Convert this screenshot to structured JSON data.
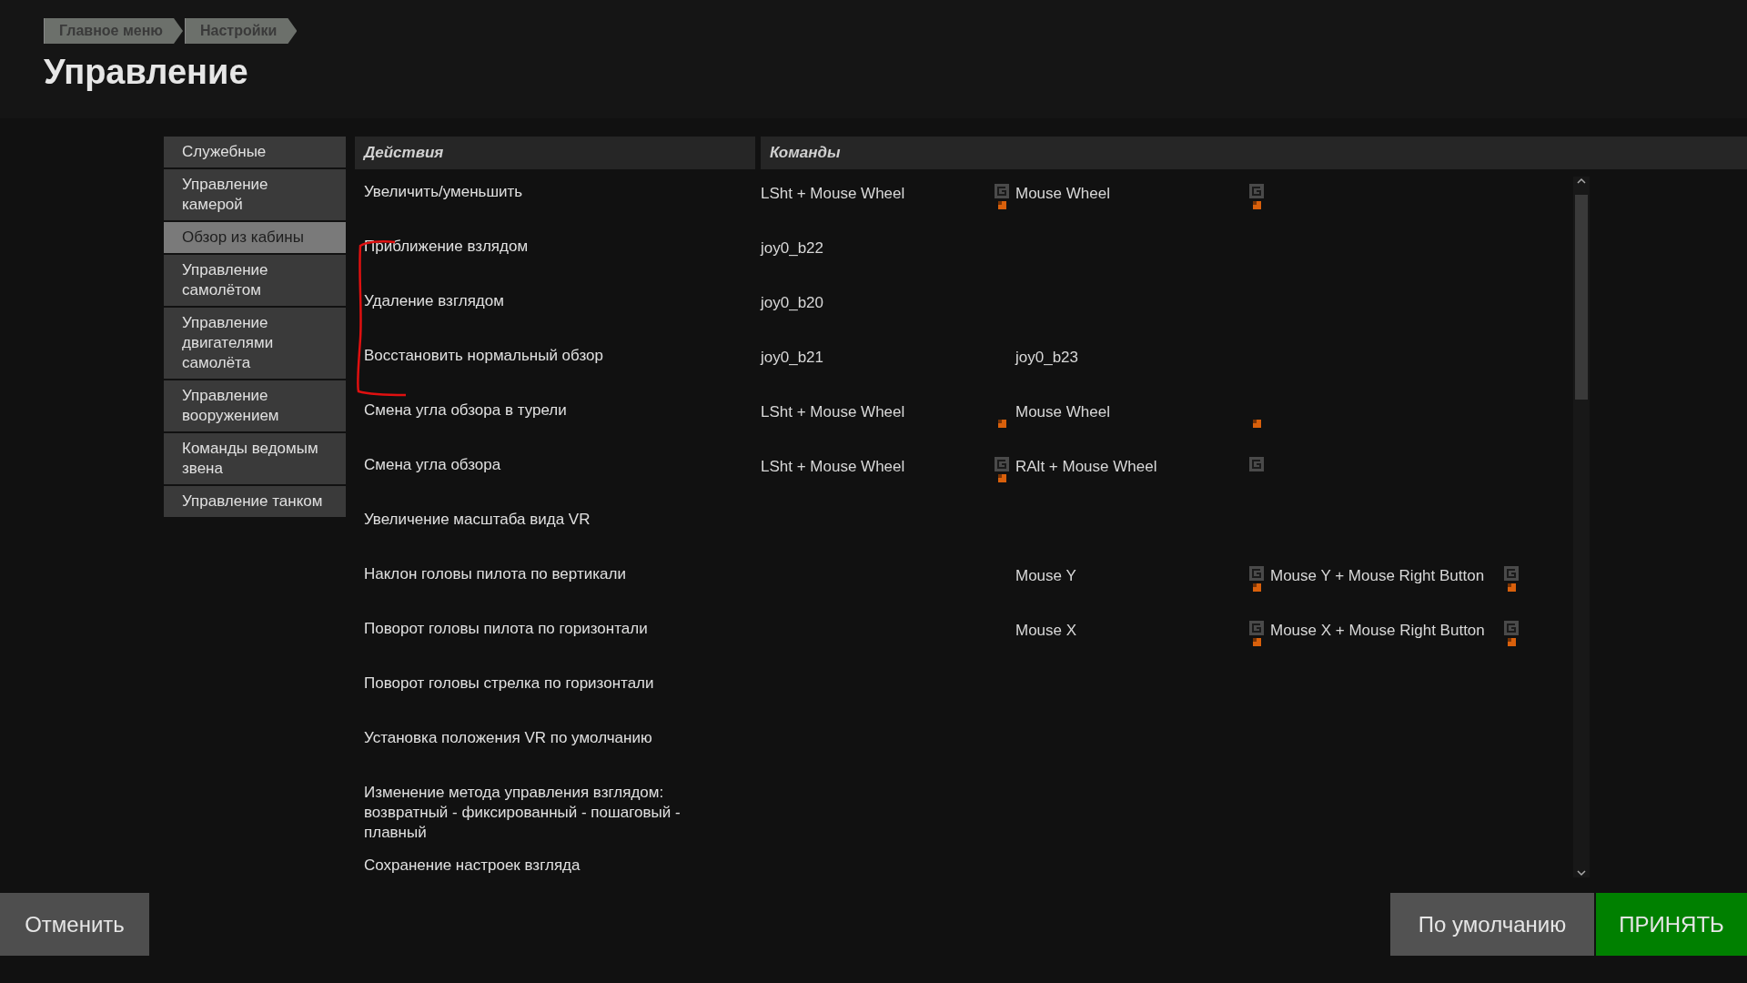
{
  "breadcrumbs": [
    "Главное меню",
    "Настройки"
  ],
  "title": "Управление",
  "sidebar": {
    "items": [
      {
        "label": "Служебные",
        "selected": false
      },
      {
        "label": "Управление камерой",
        "selected": false
      },
      {
        "label": "Обзор из кабины",
        "selected": true
      },
      {
        "label": "Управление самолётом",
        "selected": false
      },
      {
        "label": "Управление двигателями самолёта",
        "selected": false
      },
      {
        "label": "Управление вооружением",
        "selected": false
      },
      {
        "label": "Команды ведомым звена",
        "selected": false
      },
      {
        "label": "Управление танком",
        "selected": false
      }
    ]
  },
  "table": {
    "columns": [
      "Действия",
      "Команды"
    ],
    "rows": [
      {
        "action": "Увеличить/уменьшить",
        "command_1": {
          "text": "LSht + Mouse Wheel",
          "resettable": true,
          "modified": true
        },
        "command_2": {
          "text": "Mouse Wheel",
          "resettable": true,
          "modified": true
        }
      },
      {
        "action": "Приближение взлядом",
        "command_1": {
          "text": "joy0_b22",
          "resettable": false,
          "modified": false
        }
      },
      {
        "action": "Удаление взглядом",
        "command_1": {
          "text": "joy0_b20",
          "resettable": false,
          "modified": false
        }
      },
      {
        "action": "Восстановить нормальный обзор",
        "command_1": {
          "text": "joy0_b21",
          "resettable": false,
          "modified": false
        },
        "command_2": {
          "text": "joy0_b23",
          "resettable": false,
          "modified": false
        }
      },
      {
        "action": "Смена угла обзора в турели",
        "command_1": {
          "text": "LSht + Mouse Wheel",
          "resettable": false,
          "modified": true
        },
        "command_2": {
          "text": "Mouse Wheel",
          "resettable": false,
          "modified": true
        }
      },
      {
        "action": "Смена угла обзора",
        "command_1": {
          "text": "LSht + Mouse Wheel",
          "resettable": true,
          "modified": true
        },
        "command_2": {
          "text": "RAlt + Mouse Wheel",
          "resettable": true,
          "modified": false
        }
      },
      {
        "action": "Увеличение масштаба вида VR"
      },
      {
        "action": "Наклон головы пилота по вертикали",
        "command_2": {
          "text": "Mouse Y",
          "resettable": true,
          "modified": true
        },
        "command_3": {
          "text": "Mouse Y + Mouse Right Button",
          "resettable": true,
          "modified": true
        }
      },
      {
        "action": "Поворот головы пилота по горизонтали",
        "command_2": {
          "text": "Mouse X",
          "resettable": true,
          "modified": true
        },
        "command_3": {
          "text": "Mouse X + Mouse Right Button",
          "resettable": true,
          "modified": true
        }
      },
      {
        "action": "Поворот головы стрелка по горизонтали"
      },
      {
        "action": "Установка положения VR по умолчанию"
      },
      {
        "action": "Изменение метода управления взглядом: возвратный - фиксированный - пошаговый - плавный"
      },
      {
        "action": "Сохранение настроек взгляда"
      }
    ]
  },
  "buttons": {
    "cancel": "Отменить",
    "defaults": "По умолчанию",
    "accept": "ПРИНЯТЬ"
  }
}
